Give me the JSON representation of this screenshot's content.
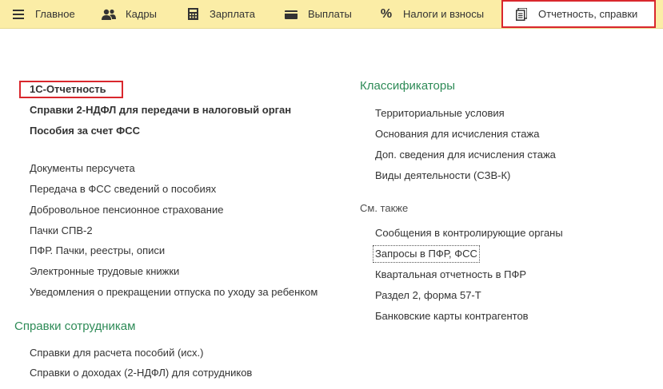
{
  "nav": {
    "items": [
      {
        "label": "Главное",
        "icon": "hamburger-menu-icon"
      },
      {
        "label": "Кадры",
        "icon": "people-icon"
      },
      {
        "label": "Зарплата",
        "icon": "calculator-icon"
      },
      {
        "label": "Выплаты",
        "icon": "wallet-icon"
      },
      {
        "label": "Налоги и взносы",
        "icon": "percent-icon"
      },
      {
        "label": "Отчетность, справки",
        "icon": "documents-icon"
      }
    ],
    "active_index": 5
  },
  "left": {
    "bold_links": [
      "1С-Отчетность",
      "Справки 2-НДФЛ для передачи в налоговый орган",
      "Пособия за счет ФСС"
    ],
    "links": [
      "Документы персучета",
      "Передача в ФСС сведений о пособиях",
      "Добровольное пенсионное страхование",
      "Пачки СПВ-2",
      "ПФР. Пачки, реестры, описи",
      "Электронные трудовые книжки",
      "Уведомления о прекращении отпуска по уходу за ребенком"
    ],
    "employee_section": {
      "title": "Справки сотрудникам",
      "links": [
        "Справки для расчета пособий (исх.)",
        "Справки о доходах (2-НДФЛ) для сотрудников"
      ]
    }
  },
  "right": {
    "classifiers": {
      "title": "Классификаторы",
      "links": [
        "Территориальные условия",
        "Основания для исчисления стажа",
        "Доп. сведения для исчисления стажа",
        "Виды деятельности (СЗВ-К)"
      ]
    },
    "see_also": {
      "title": "См. также",
      "links": [
        "Сообщения в контролирующие органы",
        "Запросы в ПФР, ФСС",
        "Квартальная отчетность в ПФР",
        "Раздел 2, форма 57-Т",
        "Банковские карты контрагентов"
      ]
    }
  },
  "colors": {
    "topbar": "#fbeda6",
    "section_title": "#2e8b57",
    "highlight_frame": "#d9272d"
  }
}
